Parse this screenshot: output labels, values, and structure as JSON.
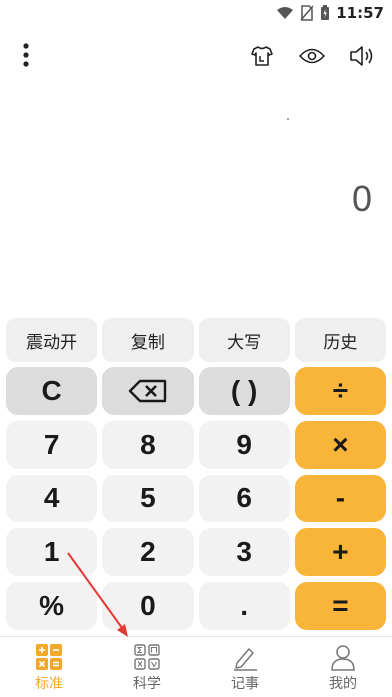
{
  "status": {
    "time": "11:57"
  },
  "display": {
    "value": "0"
  },
  "func_buttons": [
    "震动开",
    "复制",
    "大写",
    "历史"
  ],
  "keys": [
    {
      "label": "C",
      "style": "gray",
      "name": "clear-button"
    },
    {
      "label": "",
      "style": "gray",
      "name": "backspace-button",
      "icon": "backspace-icon"
    },
    {
      "label": "( )",
      "style": "gray",
      "name": "parentheses-button"
    },
    {
      "label": "÷",
      "style": "orange",
      "name": "divide-button"
    },
    {
      "label": "7",
      "style": "light",
      "name": "digit-7-button"
    },
    {
      "label": "8",
      "style": "light",
      "name": "digit-8-button"
    },
    {
      "label": "9",
      "style": "light",
      "name": "digit-9-button"
    },
    {
      "label": "×",
      "style": "orange",
      "name": "multiply-button"
    },
    {
      "label": "4",
      "style": "light",
      "name": "digit-4-button"
    },
    {
      "label": "5",
      "style": "light",
      "name": "digit-5-button"
    },
    {
      "label": "6",
      "style": "light",
      "name": "digit-6-button"
    },
    {
      "label": "-",
      "style": "orange",
      "name": "minus-button"
    },
    {
      "label": "1",
      "style": "light",
      "name": "digit-1-button"
    },
    {
      "label": "2",
      "style": "light",
      "name": "digit-2-button"
    },
    {
      "label": "3",
      "style": "light",
      "name": "digit-3-button"
    },
    {
      "label": "+",
      "style": "orange",
      "name": "plus-button"
    },
    {
      "label": "%",
      "style": "light",
      "name": "percent-button"
    },
    {
      "label": "0",
      "style": "light",
      "name": "digit-0-button"
    },
    {
      "label": ".",
      "style": "light",
      "name": "decimal-button"
    },
    {
      "label": "=",
      "style": "orange",
      "name": "equals-button"
    }
  ],
  "tabs": [
    {
      "label": "标准",
      "icon": "calculator-icon",
      "active": true
    },
    {
      "label": "科学",
      "icon": "scientific-calculator-icon",
      "active": false
    },
    {
      "label": "记事",
      "icon": "pencil-icon",
      "active": false
    },
    {
      "label": "我的",
      "icon": "user-icon",
      "active": false
    }
  ],
  "colors": {
    "accent": "#f9b43a",
    "tab_active": "#f4a82a",
    "annotation_arrow": "#e53935"
  }
}
